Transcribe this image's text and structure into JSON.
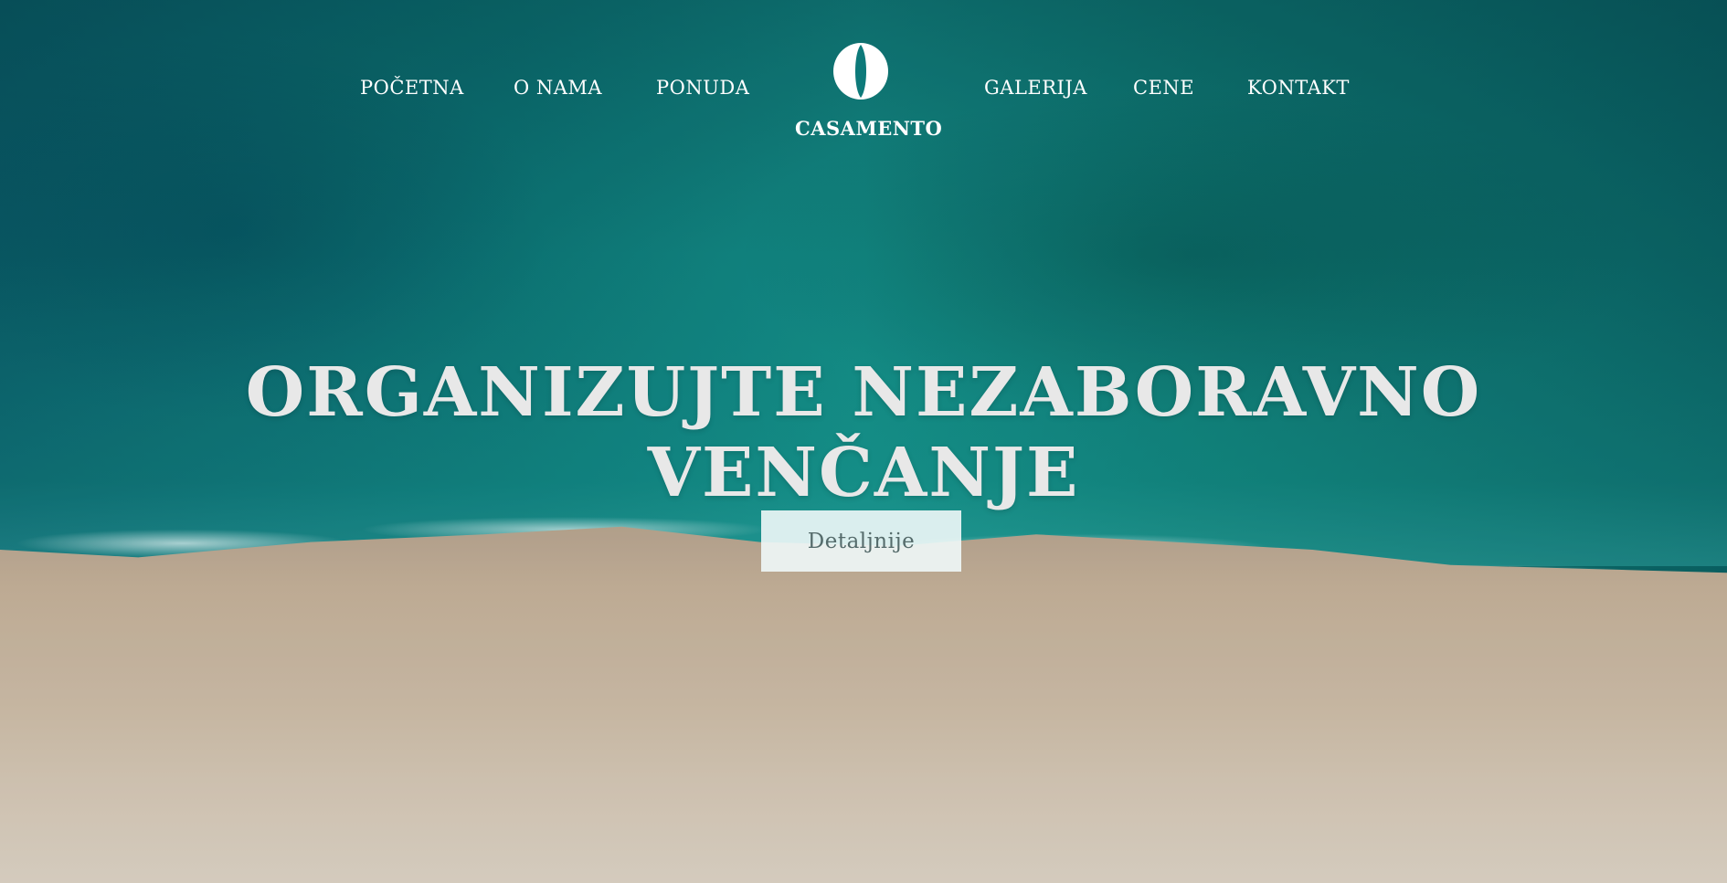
{
  "nav": {
    "items": [
      {
        "label": "POČETNA"
      },
      {
        "label": "O NAMA"
      },
      {
        "label": "PONUDA"
      },
      {
        "label": "GALERIJA"
      },
      {
        "label": "CENE"
      },
      {
        "label": "KONTAKT"
      }
    ]
  },
  "logo": {
    "text": "CASAMENTO",
    "icon": "ring-icon"
  },
  "hero": {
    "headline_line1": "ORGANIZUJTE NEZABORAVNO",
    "headline_line2": "VENČANJE",
    "cta_label": "Detaljnije",
    "background": "aerial-beach-ocean-image"
  },
  "colors": {
    "ocean": "#0d7a7a",
    "sand": "#d2c1ab",
    "headline": "#e8e8e8",
    "button_bg": "#f0f8f8",
    "button_text": "#556b6b"
  }
}
